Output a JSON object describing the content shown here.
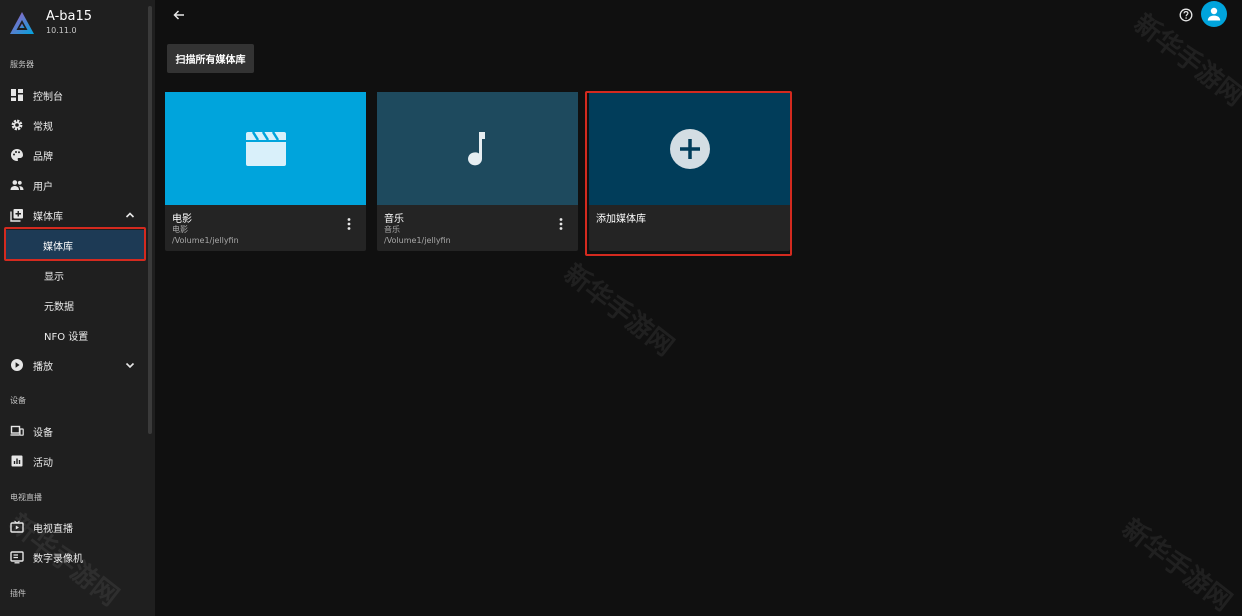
{
  "server": {
    "name": "A-ba15",
    "version": "10.11.0"
  },
  "sidebar": {
    "sections": {
      "server": "服务器",
      "devices": "设备",
      "livetv": "电视直播",
      "plugins": "插件"
    },
    "items": {
      "dashboard": "控制台",
      "general": "常规",
      "branding": "品牌",
      "users": "用户",
      "libraries": "媒体库",
      "libraries_sub": "媒体库",
      "display": "显示",
      "metadata": "元数据",
      "nfo": "NFO 设置",
      "playback": "播放",
      "devices": "设备",
      "activity": "活动",
      "livetv": "电视直播",
      "dvr": "数字录像机"
    }
  },
  "main": {
    "scan_label": "扫描所有媒体库",
    "libraries": [
      {
        "title": "电影",
        "type": "电影",
        "path": "/Volume1/jellyfin",
        "icon": "movie-clapper-icon",
        "color": "#00a4dc"
      },
      {
        "title": "音乐",
        "type": "音乐",
        "path": "/Volume1/jellyfin",
        "icon": "music-note-icon",
        "color": "#1e4a5e"
      }
    ],
    "add_label": "添加媒体库",
    "add_color": "#013d5a"
  },
  "watermark": "新华手游网",
  "colors": {
    "accent": "#00a4dc",
    "highlight": "#d42a1f",
    "selected": "#1d3a55"
  }
}
